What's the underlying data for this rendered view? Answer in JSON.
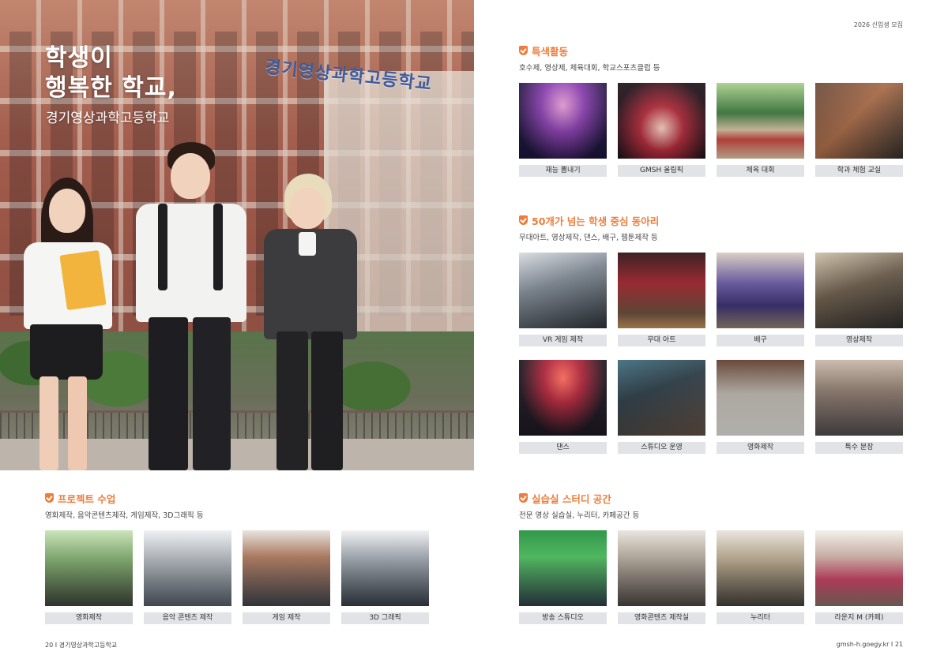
{
  "hero": {
    "title_line1": "학생이",
    "title_line2": "행복한 학교,",
    "subtitle": "경기영상과학고등학교",
    "building_sign": "경기영상과학고등학교"
  },
  "header_note": "2026 신입생 모집",
  "sections": {
    "special": {
      "title": "특색활동",
      "desc": "호수제, 영상제, 체육대회, 학교스포츠클럽 등",
      "items": [
        {
          "caption": "재능 뽐내기"
        },
        {
          "caption": "GMSH 올림픽"
        },
        {
          "caption": "체육 대회"
        },
        {
          "caption": "학과 체험 교실"
        }
      ]
    },
    "clubs": {
      "title": "50개가 넘는 학생 중심 동아리",
      "desc": "무대아트, 영상제작, 댄스, 배구, 웹툰제작 등",
      "items": [
        {
          "caption": "VR 게임 제작"
        },
        {
          "caption": "무대 아트"
        },
        {
          "caption": "배구"
        },
        {
          "caption": "영상제작"
        },
        {
          "caption": "댄스"
        },
        {
          "caption": "스튜디오 운영"
        },
        {
          "caption": "영화제작"
        },
        {
          "caption": "특수 분장"
        }
      ]
    },
    "project": {
      "title": "프로젝트 수업",
      "desc": "영화제작, 음악콘텐츠제작, 게임제작, 3D그래픽 등",
      "items": [
        {
          "caption": "영화제작"
        },
        {
          "caption": "음악 콘텐츠 제작"
        },
        {
          "caption": "게임 제작"
        },
        {
          "caption": "3D 그래픽"
        }
      ]
    },
    "study": {
      "title": "실습실 스터디 공간",
      "desc": "전문 영상 실습실, 누리터, 카페공간 등",
      "items": [
        {
          "caption": "방송 스튜디오"
        },
        {
          "caption": "영화콘텐츠 제작실"
        },
        {
          "caption": "누리터"
        },
        {
          "caption": "라운지 M (카페)"
        }
      ]
    }
  },
  "footer": {
    "left": "20 I 경기영상과학고등학교",
    "right": "gmsh-h.goegy.kr I 21"
  }
}
